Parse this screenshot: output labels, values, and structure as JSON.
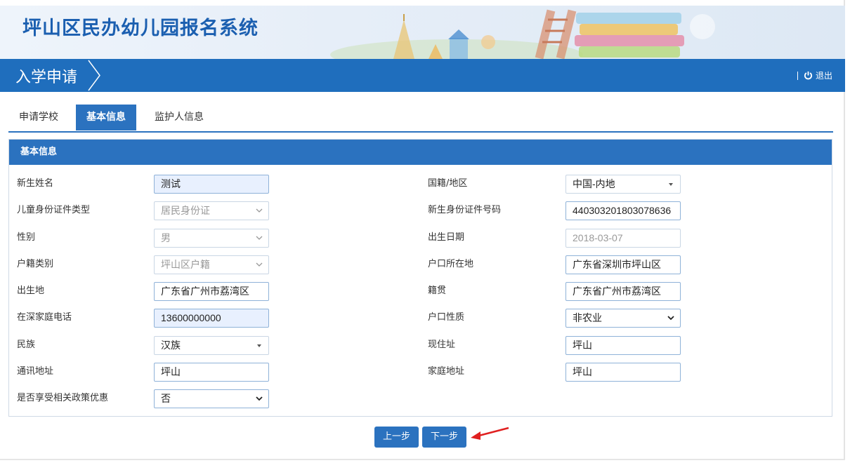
{
  "app": {
    "title": "坪山区民办幼儿园报名系统"
  },
  "nav": {
    "breadcrumb": "入学申请",
    "logout_label": "退出"
  },
  "tabs": [
    {
      "label": "申请学校",
      "active": false
    },
    {
      "label": "基本信息",
      "active": true
    },
    {
      "label": "监护人信息",
      "active": false
    }
  ],
  "panel": {
    "title": "基本信息"
  },
  "form": {
    "left": [
      {
        "label": "新生姓名",
        "value": "测试",
        "kind": "text-filled"
      },
      {
        "label": "儿童身份证件类型",
        "value": "居民身份证",
        "kind": "select-disabled"
      },
      {
        "label": "性别",
        "value": "男",
        "kind": "select-disabled"
      },
      {
        "label": "户籍类别",
        "value": "坪山区户籍",
        "kind": "select-disabled"
      },
      {
        "label": "出生地",
        "value": "广东省广州市荔湾区",
        "kind": "text"
      },
      {
        "label": "在深家庭电话",
        "value": "13600000000",
        "kind": "text-filled"
      },
      {
        "label": "民族",
        "value": "汉族",
        "kind": "dropdown"
      },
      {
        "label": "通讯地址",
        "value": "坪山",
        "kind": "text"
      },
      {
        "label": "是否享受相关政策优惠",
        "value": "否",
        "kind": "select"
      }
    ],
    "right": [
      {
        "label": "国籍/地区",
        "value": "中国-内地",
        "kind": "dropdown"
      },
      {
        "label": "新生身份证件号码",
        "value": "440303201803078636",
        "kind": "text"
      },
      {
        "label": "出生日期",
        "value": "2018-03-07",
        "kind": "text-disabled"
      },
      {
        "label": "户口所在地",
        "value": "广东省深圳市坪山区",
        "kind": "text"
      },
      {
        "label": "籍贯",
        "value": "广东省广州市荔湾区",
        "kind": "text"
      },
      {
        "label": "户口性质",
        "value": "非农业",
        "kind": "select"
      },
      {
        "label": "现住址",
        "value": "坪山",
        "kind": "text"
      },
      {
        "label": "家庭地址",
        "value": "坪山",
        "kind": "text"
      }
    ]
  },
  "buttons": {
    "prev": "上一步",
    "next": "下一步"
  },
  "colors": {
    "primary": "#2b72bf",
    "nav": "#1f6ebd",
    "title": "#1b5fb0",
    "arrow": "#e02020"
  }
}
